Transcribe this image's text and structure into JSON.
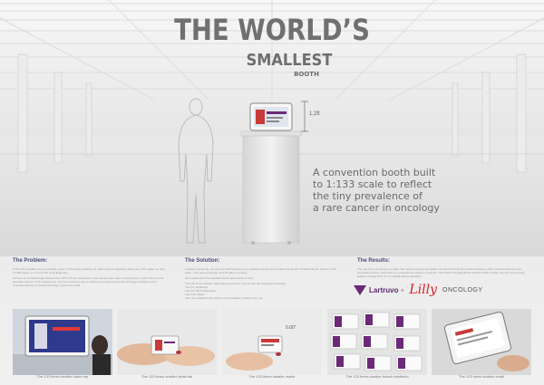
{
  "headline": {
    "line1": "THE WORLD’S",
    "line2": "SMALLEST",
    "line3": "BOOTH"
  },
  "height_label": "1,2ft",
  "tagline": [
    "A convention booth built",
    "to 1:133 scale to reflect",
    "the tiny prevalence of",
    "a rare cancer in oncology"
  ],
  "problem": {
    "heading": "The Problem:",
    "paragraphs": [
      "STS is an incredibly rare and deadly cancer. Of the approximately 1.6 million cancer diagnoses each year, STS makes up only 12,000 cases, or 1 out of 133 of all diagnoses.",
      "Lartruvo is a breakthrough treatment for STS, but the small scale of the disease has made it challenging to reach doctors and generate interest. At the tradeshows, Lartruvo needed a way to stand out amongst big booths and bigger budgets at the American Society of Clinical Oncology Convention 2018."
    ]
  },
  "solution": {
    "heading": "The Solution:",
    "paragraphs": [
      "Instead of going big, we took our booth design in the opposite direction and created the World's Smallest Booth, built to 1:133 scale – the same proportion of STS within oncology.",
      "We created all of the standard booth tactics down to size:"
    ],
    "items": [
      "The 133 Times Smaller Sales Rep greeted the curious through hologram technology",
      "The 0.0\" Detail Aid",
      "The 0.0\" Brand Manifesto",
      "The 0.00\" Mailer",
      "Also, we emailed booth visitors at the smallest possible size, 1pt"
    ]
  },
  "results": {
    "heading": "The Results:",
    "paragraphs": [
      "The Lilly Onc community is smaller than other oncology specialties. We identified Lilly Onc doctors based on their medical treatment and prescribing history, which led us to prioritize the doctors of interest. The World's Smallest Booth attracted 190 of these Lilly Onc key thought leaders, roughly 97% of our original target population."
    ]
  },
  "brand": {
    "lartruvo": "Lartruvo",
    "registered": "®",
    "lilly": "Lilly",
    "oncology": "ONCOLOGY"
  },
  "thumbnails": [
    {
      "caption": "The 133 times smaller sales rep",
      "label": ""
    },
    {
      "caption": "The 133 times smaller detail aid",
      "label": ""
    },
    {
      "caption": "The 133 times smaller mailer",
      "label": "0.00\""
    },
    {
      "caption": "The 133 times smaller brand manifesto",
      "label": ""
    },
    {
      "caption": "The 133 times smaller email",
      "label": ""
    }
  ],
  "colors": {
    "heading_purple": "#4a4a7a",
    "lartruvo_purple": "#6b2a77",
    "lilly_red": "#d81f26"
  }
}
